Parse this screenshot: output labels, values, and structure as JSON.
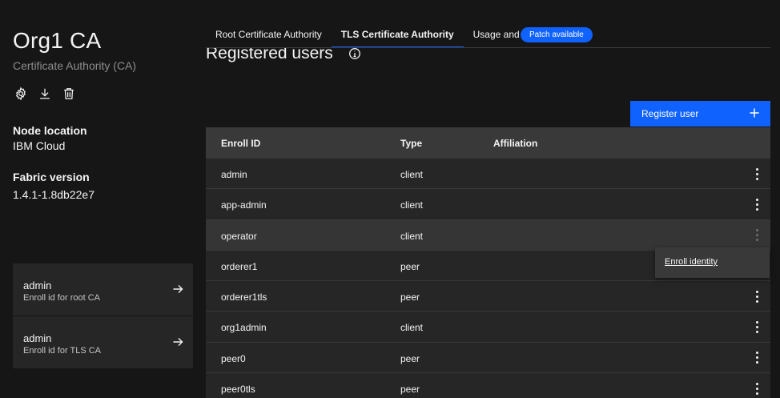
{
  "ca": {
    "title": "Org1 CA",
    "subtitle": "Certificate Authority (CA)"
  },
  "actions": {
    "settings_icon": "gear-icon",
    "download_icon": "download-icon",
    "delete_icon": "trash-icon"
  },
  "node_location": {
    "label": "Node location",
    "value": "IBM Cloud"
  },
  "fabric_version": {
    "label": "Fabric version",
    "value": "1.4.1-1.8db22e7"
  },
  "identity_tiles": [
    {
      "name": "admin",
      "description": "Enroll id for root CA"
    },
    {
      "name": "admin",
      "description": "Enroll id for TLS CA"
    }
  ],
  "tabs": [
    {
      "label": "Root Certificate Authority",
      "active": false
    },
    {
      "label": "TLS Certificate Authority",
      "active": true
    },
    {
      "label": "Usage and info",
      "active": false
    }
  ],
  "badge": {
    "label": "Patch available"
  },
  "section": {
    "title": "Registered users"
  },
  "register_button": {
    "label": "Register user"
  },
  "table": {
    "headers": [
      "Enroll ID",
      "Type",
      "Affiliation"
    ],
    "rows": [
      {
        "enroll_id": "admin",
        "type": "client",
        "affiliation": ""
      },
      {
        "enroll_id": "app-admin",
        "type": "client",
        "affiliation": ""
      },
      {
        "enroll_id": "operator",
        "type": "client",
        "affiliation": ""
      },
      {
        "enroll_id": "orderer1",
        "type": "peer",
        "affiliation": ""
      },
      {
        "enroll_id": "orderer1tls",
        "type": "peer",
        "affiliation": ""
      },
      {
        "enroll_id": "org1admin",
        "type": "client",
        "affiliation": ""
      },
      {
        "enroll_id": "peer0",
        "type": "peer",
        "affiliation": ""
      },
      {
        "enroll_id": "peer0tls",
        "type": "peer",
        "affiliation": ""
      }
    ]
  },
  "overflow_menu": {
    "items": [
      {
        "label": "Enroll identity"
      }
    ]
  },
  "colors": {
    "accent": "#0f62fe",
    "background": "#161616",
    "surface": "#262626",
    "header": "#393939"
  }
}
